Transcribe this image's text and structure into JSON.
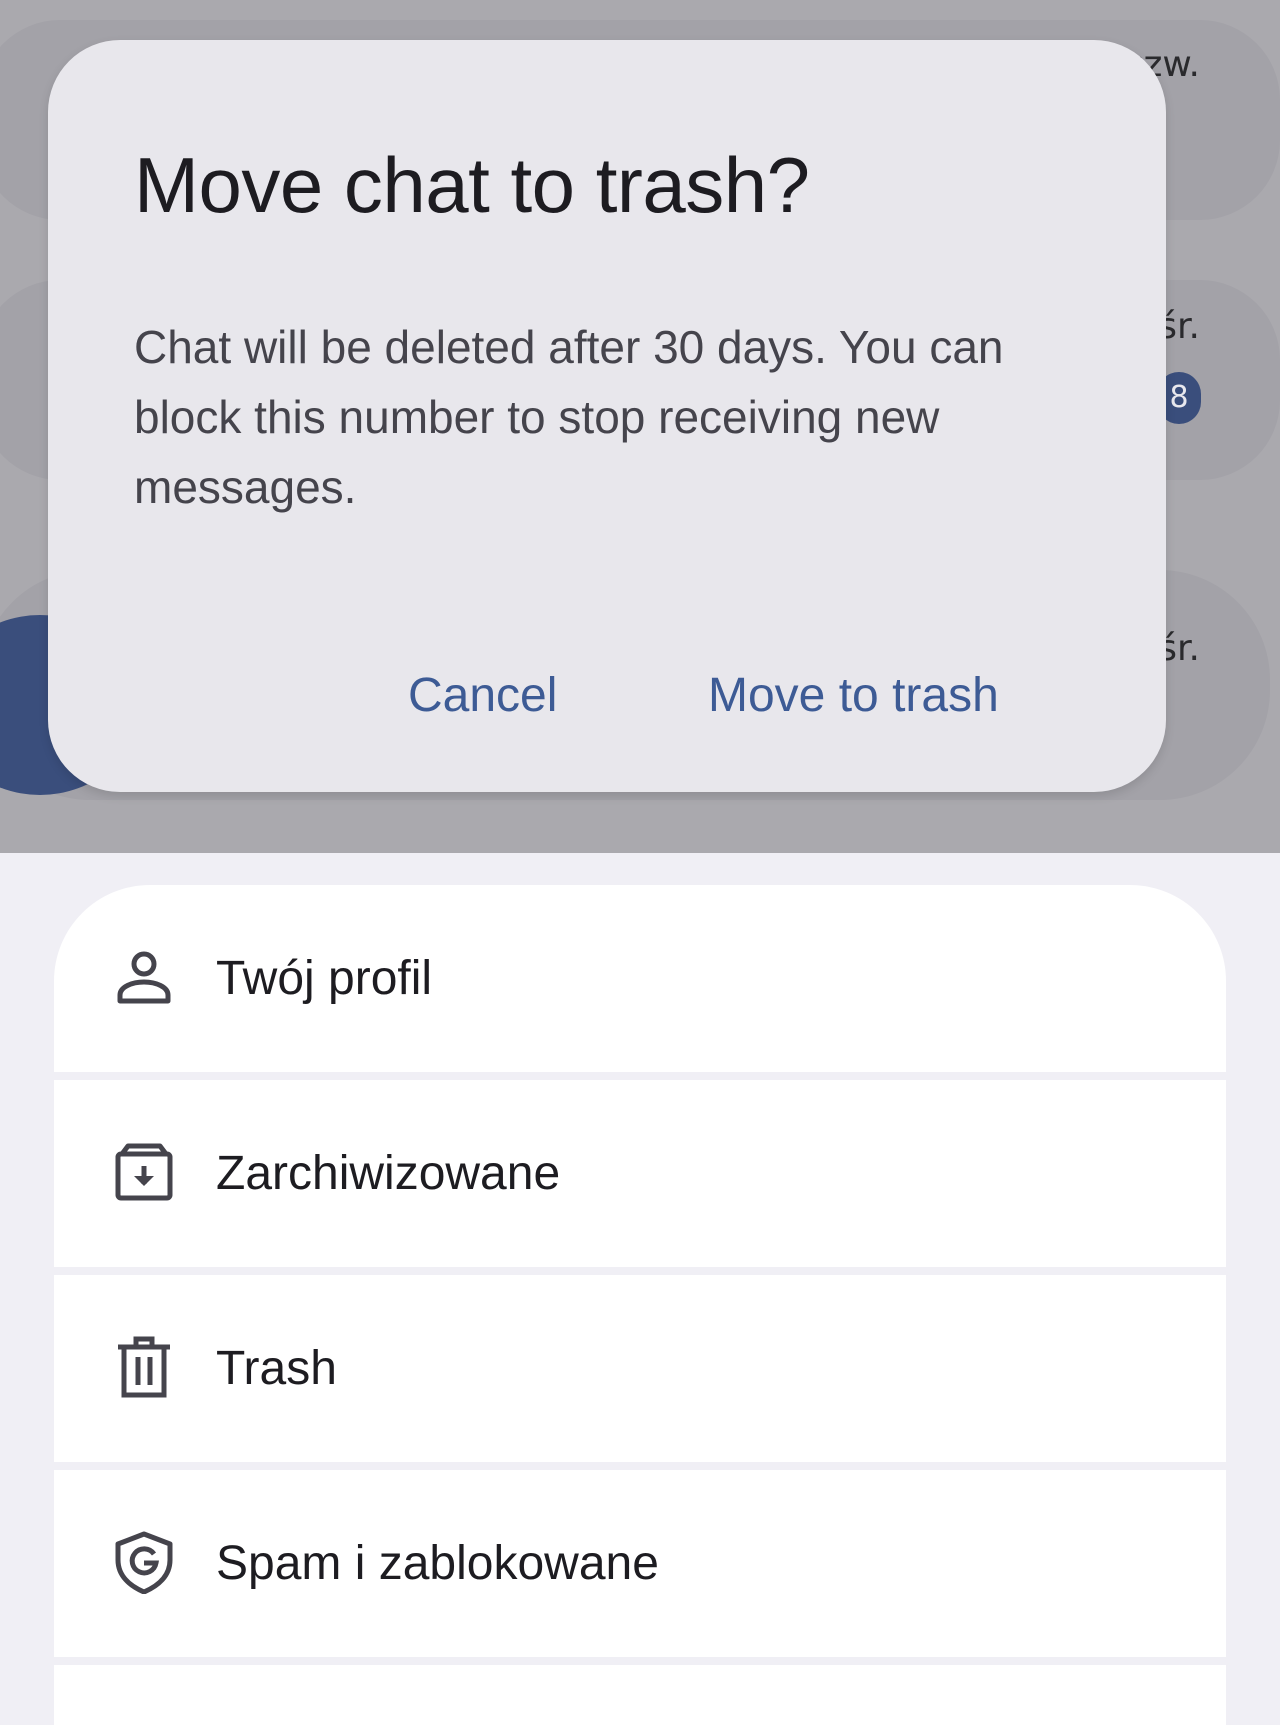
{
  "background": {
    "times": [
      "czw.",
      "śr.",
      "śr."
    ],
    "badge": "8"
  },
  "dialog": {
    "title": "Move chat to trash?",
    "body": "Chat will be deleted after 30 days. You can block this number to stop receiving new messages.",
    "cancel_label": "Cancel",
    "confirm_label": "Move to trash"
  },
  "menu": {
    "items": [
      {
        "label": "Twój profil",
        "icon": "person-icon"
      },
      {
        "label": "Zarchiwizowane",
        "icon": "archive-icon"
      },
      {
        "label": "Trash",
        "icon": "trash-icon"
      },
      {
        "label": "Spam i zablokowane",
        "icon": "shield-g-icon"
      }
    ]
  },
  "colors": {
    "scrim": "#aaa9ae",
    "dialog_bg": "#e8e7ec",
    "accent": "#3d5b95",
    "page_bg": "#f0eff5",
    "menu_bg": "#ffffff"
  }
}
